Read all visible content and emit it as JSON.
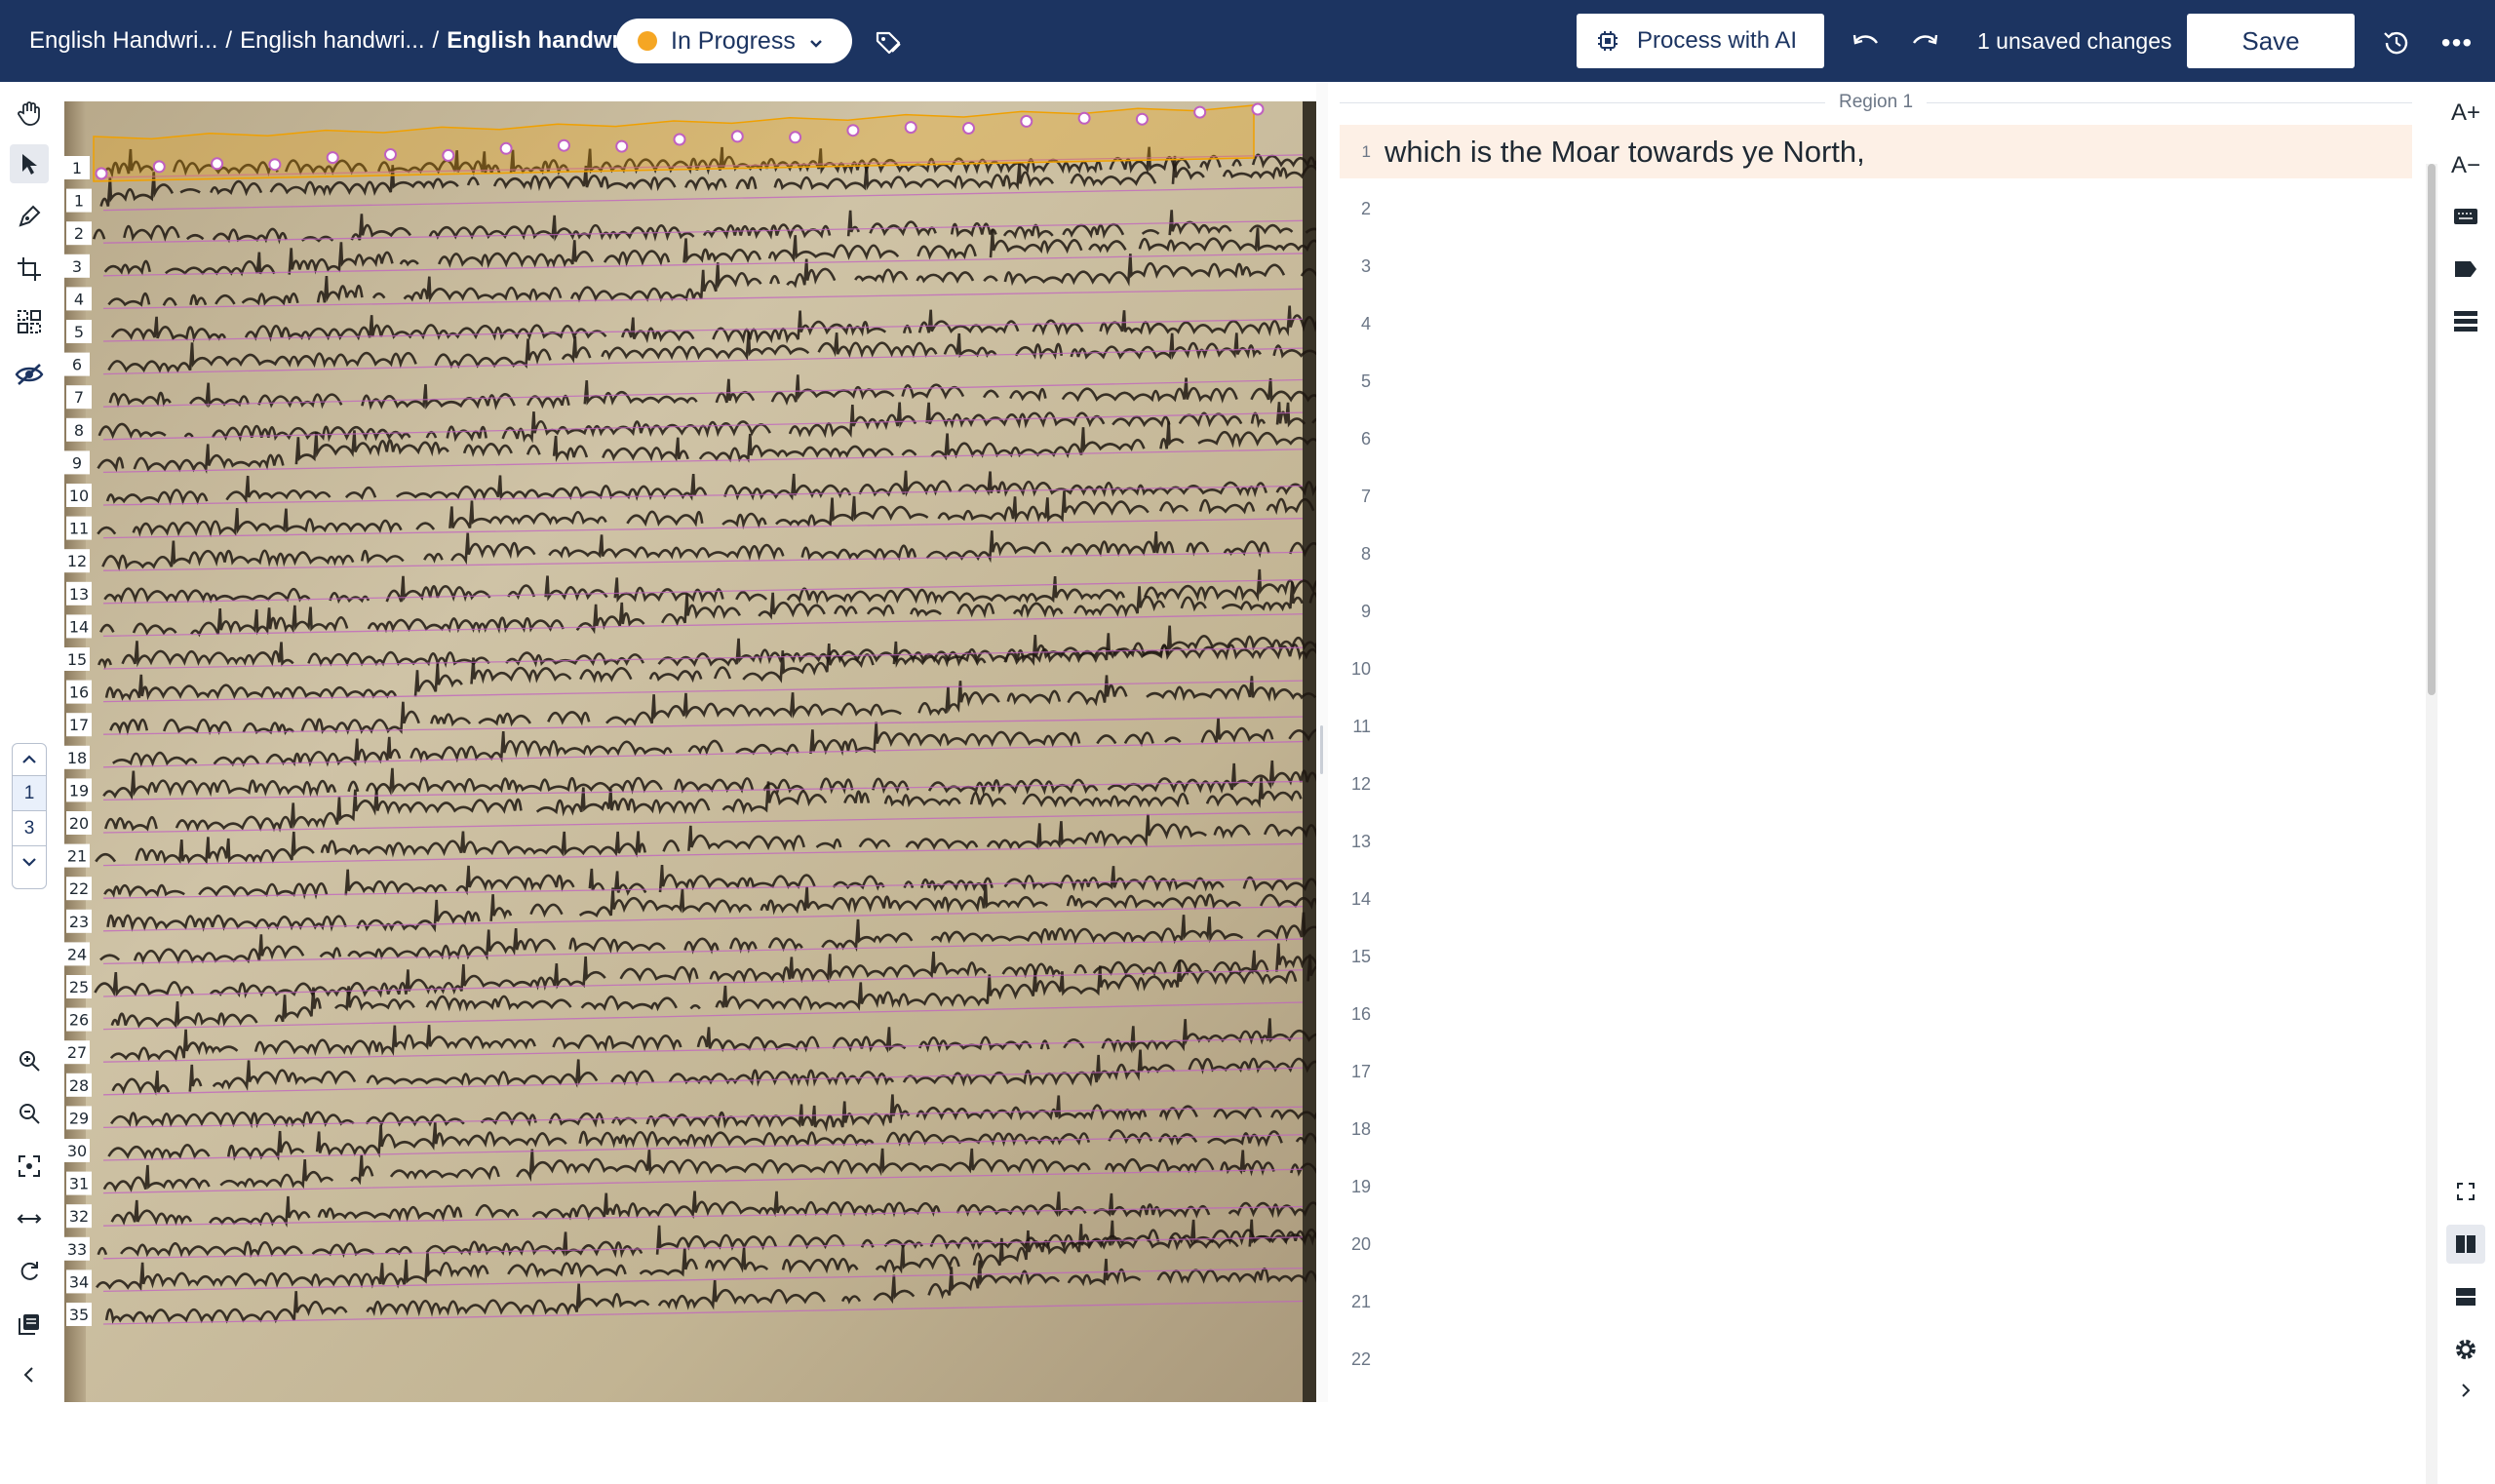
{
  "breadcrumb": {
    "item1": "English Handwri...",
    "item2": "English handwri...",
    "item3": "English handwri...",
    "separator": "/"
  },
  "status": {
    "label": "In Progress",
    "color": "#f5a623"
  },
  "toolbar": {
    "ai_label": "Process with AI",
    "unsaved_text": "1 unsaved changes",
    "save_label": "Save"
  },
  "pager": {
    "current": "1",
    "total": "3"
  },
  "region": {
    "label": "Region 1"
  },
  "lines": [
    {
      "no": "1",
      "text": "which is the Moar towards ye North,"
    },
    {
      "no": "2",
      "text": ""
    },
    {
      "no": "3",
      "text": ""
    },
    {
      "no": "4",
      "text": ""
    },
    {
      "no": "5",
      "text": ""
    },
    {
      "no": "6",
      "text": ""
    },
    {
      "no": "7",
      "text": ""
    },
    {
      "no": "8",
      "text": ""
    },
    {
      "no": "9",
      "text": ""
    },
    {
      "no": "10",
      "text": ""
    },
    {
      "no": "11",
      "text": ""
    },
    {
      "no": "12",
      "text": ""
    },
    {
      "no": "13",
      "text": ""
    },
    {
      "no": "14",
      "text": ""
    },
    {
      "no": "15",
      "text": ""
    },
    {
      "no": "16",
      "text": ""
    },
    {
      "no": "17",
      "text": ""
    },
    {
      "no": "18",
      "text": ""
    },
    {
      "no": "19",
      "text": ""
    },
    {
      "no": "20",
      "text": ""
    },
    {
      "no": "21",
      "text": ""
    },
    {
      "no": "22",
      "text": ""
    }
  ],
  "image_line_markers": [
    "1",
    "1",
    "2",
    "3",
    "4",
    "5",
    "6",
    "7",
    "8",
    "9",
    "10",
    "11",
    "12",
    "13",
    "14",
    "15",
    "16",
    "17",
    "18",
    "19",
    "20",
    "21",
    "22",
    "23",
    "24",
    "25",
    "26",
    "27",
    "28",
    "29",
    "30",
    "31",
    "32",
    "33",
    "34",
    "35"
  ],
  "right_tools": {
    "font_increase": "A+",
    "font_decrease": "A−"
  },
  "colors": {
    "header_bg": "#1c3461",
    "active_line_bg": "#fdf0e6",
    "baseline": "#c060c0",
    "polygon": "#f0a000"
  }
}
